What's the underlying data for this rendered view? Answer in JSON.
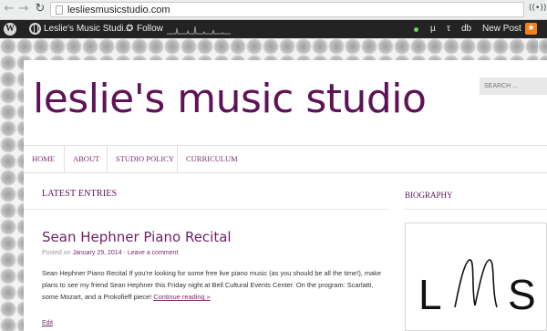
{
  "browser": {
    "url": "lesliesmusicstudio.com"
  },
  "admin_bar": {
    "site_name": "Leslie's Music Studi...",
    "follow": "Follow",
    "mu": "µ",
    "tau": "τ",
    "db": "db",
    "new_post": "New Post",
    "status_color": "#6bd35a",
    "notification_color": "#f0821e"
  },
  "site": {
    "title": "leslie's music studio",
    "search_placeholder": "SEARCH ...",
    "accent_color": "#5e1258"
  },
  "nav": {
    "items": [
      {
        "label": "HOME"
      },
      {
        "label": "ABOUT"
      },
      {
        "label": "STUDIO POLICY"
      },
      {
        "label": "CURRICULUM"
      }
    ]
  },
  "main": {
    "section_heading": "LATEST ENTRIES",
    "post": {
      "title": "Sean Hephner Piano Recital",
      "posted_on": "Posted on",
      "date": "January 29, 2014",
      "separator": " - ",
      "comment_link": "Leave a comment",
      "excerpt": "Sean Hephner Piano Recital If you're looking for some free live piano music (as you should be all the time!), make plans to see my friend Sean Hephner this Friday night at Bell Cultural Events Center. On the program: Scarlatti, some Mozart, and a Prokofieff piece!",
      "continue_reading": "Continue reading »",
      "edit": "Edit"
    }
  },
  "sidebar": {
    "heading": "BIOGRAPHY",
    "logo_letters": "LMS"
  }
}
